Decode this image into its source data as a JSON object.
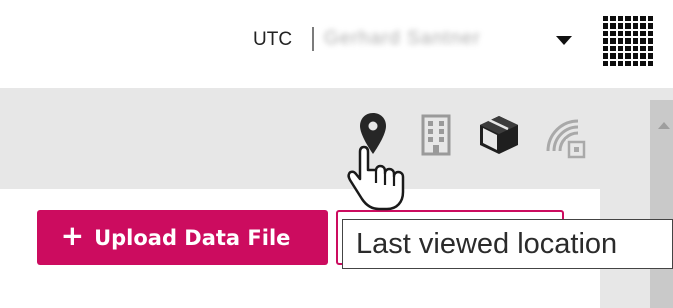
{
  "header": {
    "timezone": "UTC",
    "user_name": "Gerhard Santner"
  },
  "toolbar": {
    "icons": [
      "location-pin-icon",
      "building-icon",
      "package-icon",
      "signal-icon"
    ]
  },
  "actions": {
    "upload_label": "Upload Data File",
    "upload_icon": "plus-icon"
  },
  "tooltip": {
    "text": "Last viewed location"
  },
  "colors": {
    "accent": "#cc0c5f",
    "toolbar_bg": "#e7e7e7"
  }
}
